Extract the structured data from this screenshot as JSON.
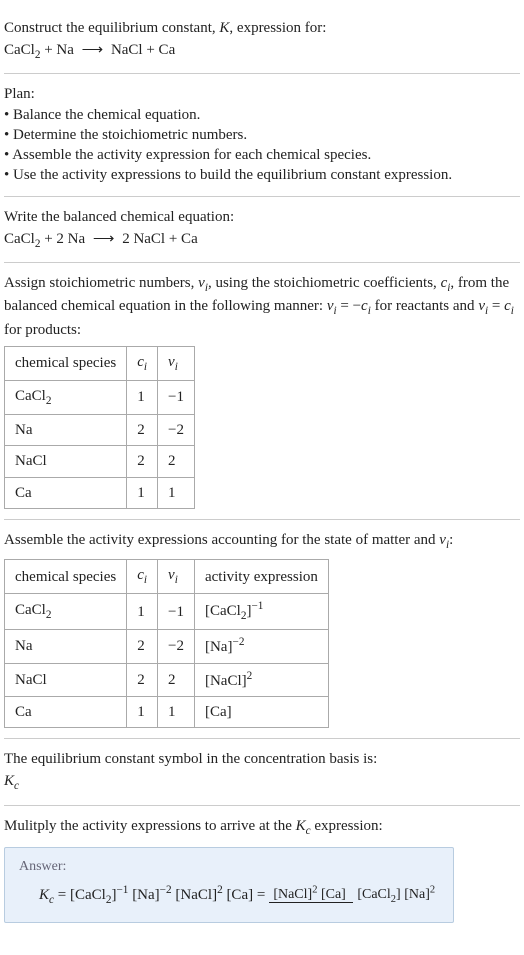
{
  "intro": {
    "line1_prefix": "Construct the equilibrium constant, ",
    "line1_k": "K",
    "line1_suffix": ", expression for:",
    "eq_lhs": "CaCl",
    "eq_sub1": "2",
    "eq_plus1": " + Na  ",
    "eq_arrow": "⟶",
    "eq_rhs": "  NaCl + Ca"
  },
  "plan": {
    "heading": "Plan:",
    "items": [
      "Balance the chemical equation.",
      "Determine the stoichiometric numbers.",
      "Assemble the activity expression for each chemical species.",
      "Use the activity expressions to build the equilibrium constant expression."
    ]
  },
  "balanced": {
    "heading": "Write the balanced chemical equation:",
    "lhs1": "CaCl",
    "lhs1_sub": "2",
    "lhs2": " + 2 Na  ",
    "arrow": "⟶",
    "rhs": "  2 NaCl + Ca"
  },
  "stoich": {
    "text_a": "Assign stoichiometric numbers, ",
    "nu": "ν",
    "sub_i": "i",
    "text_b": ", using the stoichiometric coefficients, ",
    "c": "c",
    "text_c": ", from the balanced chemical equation in the following manner: ",
    "rel1_a": "ν",
    "rel1_b": " = −",
    "rel1_c": "c",
    "text_d": " for reactants and ",
    "rel2_a": "ν",
    "rel2_b": " = ",
    "rel2_c": "c",
    "text_e": " for products:",
    "headers": [
      "chemical species",
      "c",
      "ν"
    ],
    "rows": [
      {
        "species": "CaCl",
        "sub": "2",
        "c": "1",
        "nu": "−1"
      },
      {
        "species": "Na",
        "sub": "",
        "c": "2",
        "nu": "−2"
      },
      {
        "species": "NaCl",
        "sub": "",
        "c": "2",
        "nu": "2"
      },
      {
        "species": "Ca",
        "sub": "",
        "c": "1",
        "nu": "1"
      }
    ]
  },
  "activity": {
    "text_a": "Assemble the activity expressions accounting for the state of matter and ",
    "nu": "ν",
    "sub_i": "i",
    "text_b": ":",
    "headers": [
      "chemical species",
      "c",
      "ν",
      "activity expression"
    ],
    "rows": [
      {
        "species": "CaCl",
        "sub": "2",
        "c": "1",
        "nu": "−1",
        "act_l": "[CaCl",
        "act_sub": "2",
        "act_r": "]",
        "exp": "−1"
      },
      {
        "species": "Na",
        "sub": "",
        "c": "2",
        "nu": "−2",
        "act_l": "[Na",
        "act_sub": "",
        "act_r": "]",
        "exp": "−2"
      },
      {
        "species": "NaCl",
        "sub": "",
        "c": "2",
        "nu": "2",
        "act_l": "[NaCl",
        "act_sub": "",
        "act_r": "]",
        "exp": "2"
      },
      {
        "species": "Ca",
        "sub": "",
        "c": "1",
        "nu": "1",
        "act_l": "[Ca",
        "act_sub": "",
        "act_r": "]",
        "exp": ""
      }
    ]
  },
  "symbol": {
    "text": "The equilibrium constant symbol in the concentration basis is:",
    "kc_k": "K",
    "kc_c": "c"
  },
  "multiply": {
    "text_a": "Mulitply the activity expressions to arrive at the ",
    "kc_k": "K",
    "kc_c": "c",
    "text_b": " expression:"
  },
  "answer": {
    "label": "Answer:",
    "kc_k": "K",
    "kc_c": "c",
    "eq": " = ",
    "t1": "[CaCl",
    "t1_sub": "2",
    "t1_r": "]",
    "t1_exp": "−1",
    "t2": " [Na]",
    "t2_exp": "−2",
    "t3": " [NaCl]",
    "t3_exp": "2",
    "t4": " [Ca] = ",
    "num_a": "[NaCl]",
    "num_a_exp": "2",
    "num_b": " [Ca]",
    "den_a": "[CaCl",
    "den_a_sub": "2",
    "den_a_r": "] [Na]",
    "den_a_exp": "2"
  }
}
